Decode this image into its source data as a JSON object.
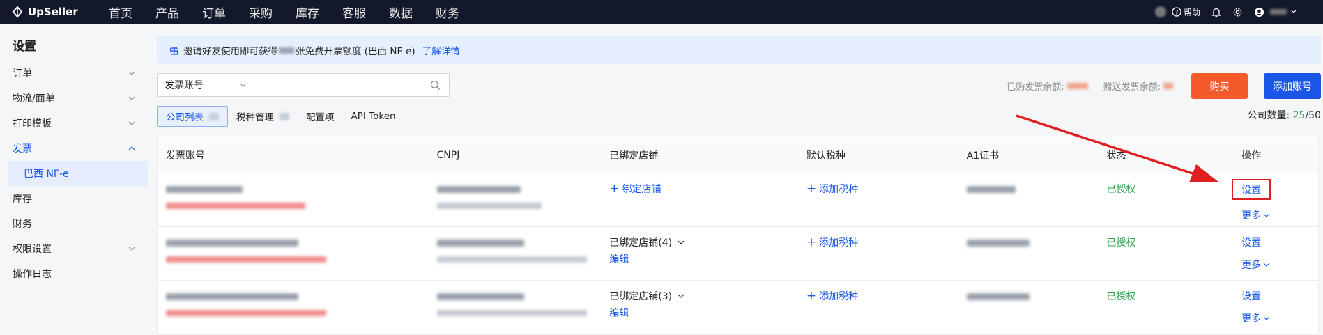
{
  "topbar": {
    "logo": "UpSeller",
    "nav": [
      "首页",
      "产品",
      "订单",
      "采购",
      "库存",
      "客服",
      "数据",
      "财务"
    ],
    "help": "帮助"
  },
  "sidebar": {
    "title": "设置",
    "items": [
      {
        "label": "订单",
        "expandable": true
      },
      {
        "label": "物流/面单",
        "expandable": true
      },
      {
        "label": "打印模板",
        "expandable": true
      },
      {
        "label": "发票",
        "expandable": true,
        "expanded": true
      },
      {
        "label": "巴西 NF-e",
        "sub": true
      },
      {
        "label": "库存"
      },
      {
        "label": "财务"
      },
      {
        "label": "权限设置",
        "expandable": true
      },
      {
        "label": "操作日志"
      }
    ]
  },
  "banner": {
    "text_before": "邀请好友使用即可获得",
    "text_after": "张免费开票额度 (巴西 NF-e)",
    "link": "了解详情"
  },
  "search": {
    "select_value": "发票账号",
    "input_value": ""
  },
  "balances": {
    "purchased_label": "已购发票余额:",
    "gift_label": "赠送发票余额:",
    "buy_button": "购买",
    "add_button": "添加账号"
  },
  "tabs": [
    {
      "label": "公司列表",
      "active": true
    },
    {
      "label": "税种管理"
    },
    {
      "label": "配置项"
    },
    {
      "label": "API Token"
    }
  ],
  "count": {
    "label": "公司数量: ",
    "used": "25",
    "total": "/50"
  },
  "table": {
    "headers": [
      "发票账号",
      "CNPJ",
      "已绑定店铺",
      "默认税种",
      "A1证书",
      "状态",
      "操作"
    ],
    "rows": [
      {
        "shop": "绑定店铺",
        "shop_type": "add",
        "tax": "添加税种",
        "status": "已授权",
        "action": "设置",
        "more": "更多"
      },
      {
        "shop": "已绑定店铺(4)",
        "shop_type": "bound",
        "edit": "编辑",
        "tax": "添加税种",
        "status": "已授权",
        "action": "设置",
        "more": "更多"
      },
      {
        "shop": "已绑定店铺(3)",
        "shop_type": "bound",
        "edit": "编辑",
        "tax": "添加税种",
        "status": "已授权",
        "action": "设置",
        "more": "更多"
      }
    ]
  },
  "colors": {
    "accent": "#1a57e6",
    "buy": "#f45a2a",
    "status_green": "#2ea04a",
    "annotation_red": "#e02020"
  }
}
